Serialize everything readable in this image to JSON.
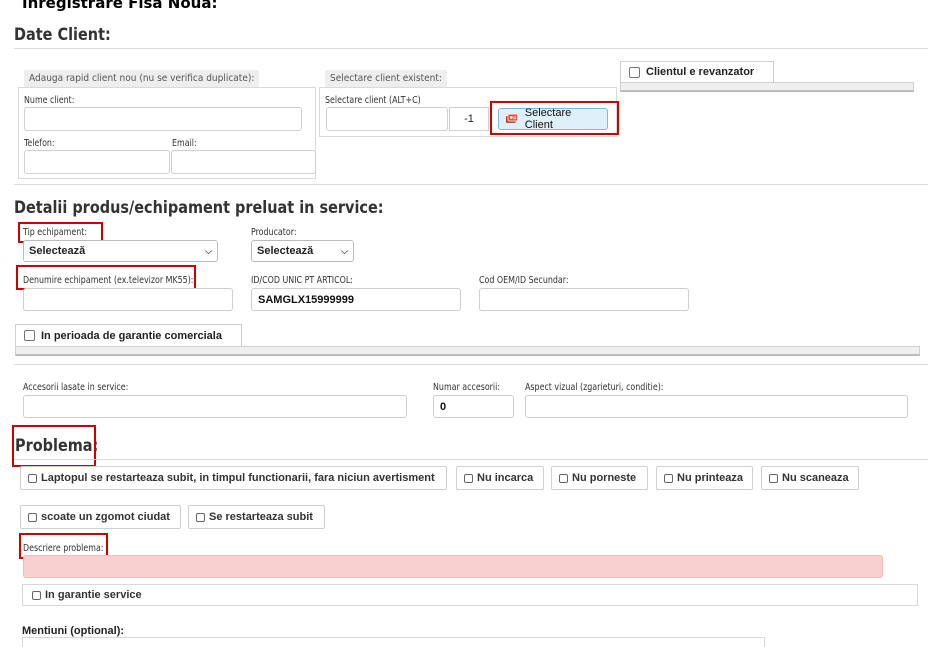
{
  "page": {
    "title": "Inregistrare Fisa Noua:",
    "sections": {
      "client": "Date Client:",
      "product": "Detalii produs/echipament preluat in service:",
      "problem": "Problema:"
    }
  },
  "client": {
    "quick_add_label": "Adauga rapid client nou (nu se verifica duplicate):",
    "name_label": "Nume client:",
    "name_value": "",
    "phone_label": "Telefon:",
    "phone_value": "",
    "email_label": "Email:",
    "email_value": "",
    "existing_label": "Selectare client existent:",
    "select_label": "Selectare client (ALT+C)",
    "select_value": "",
    "id_value": "-1",
    "select_button": "Selectare Client",
    "reseller_label": "Clientul e revanzator"
  },
  "product": {
    "type_label": "Tip echipament:",
    "type_value": "Selectează",
    "producer_label": "Producator:",
    "producer_value": "Selectează",
    "name_label": "Denumire echipament (ex.televizor MK55):",
    "name_value": "",
    "uid_label": "ID/COD UNIC PT ARTICOL:",
    "uid_value": "SAMGLX15999999",
    "oem_label": "Cod OEM/ID Secundar:",
    "oem_value": "",
    "warranty_label": "In perioada de garantie comerciala",
    "accessories_label": "Accesorii lasate in service:",
    "accessories_value": "",
    "acc_count_label": "Numar accesorii:",
    "acc_count_value": "0",
    "aspect_label": "Aspect vizual (zgarieturi, conditie):",
    "aspect_value": ""
  },
  "problem": {
    "chips": [
      "Laptopul se restarteaza subit, in timpul functionarii, fara niciun avertisment",
      "Nu incarca",
      "Nu porneste",
      "Nu printeaza",
      "Nu scaneaza",
      "scoate un zgomot ciudat",
      "Se restarteaza subit"
    ],
    "description_label": "Descriere problema:",
    "description_value": "",
    "service_warranty_label": "In garantie service",
    "mentions_label": "Mentiuni (optional):"
  },
  "colors": {
    "highlight_red": "#d10000",
    "required_pink": "#f8d0d0",
    "button_blue": "#dff0fa"
  }
}
